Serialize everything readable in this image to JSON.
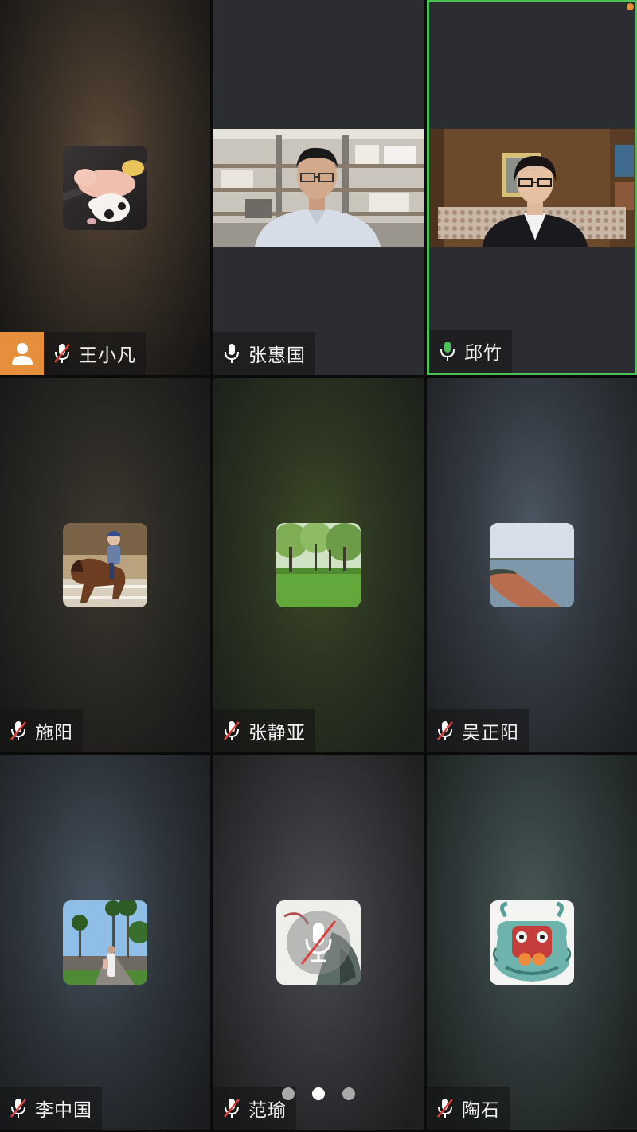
{
  "participants": [
    {
      "name": "王小凡",
      "mic": "muted",
      "host": true,
      "avatar": "pig-figurines-photo"
    },
    {
      "name": "张惠国",
      "mic": "on",
      "video": "man-in-office-video"
    },
    {
      "name": "邱竹",
      "mic": "speaking",
      "video": "woman-in-study-video",
      "active_speaker": true
    },
    {
      "name": "施阳",
      "mic": "muted",
      "avatar": "child-on-horse-photo"
    },
    {
      "name": "张静亚",
      "mic": "muted",
      "avatar": "park-trees-photo"
    },
    {
      "name": "吴正阳",
      "mic": "muted",
      "avatar": "lakeside-path-photo"
    },
    {
      "name": "李中国",
      "mic": "muted",
      "avatar": "palm-road-photo"
    },
    {
      "name": "范瑜",
      "mic": "muted",
      "avatar": "ink-lotus-muted-photo"
    },
    {
      "name": "陶石",
      "mic": "muted",
      "avatar": "dragon-mask-illustration"
    }
  ],
  "pagination": {
    "total": 3,
    "current": 2
  },
  "colors": {
    "active_speaker": "#4cc159",
    "host_badge": "#e58e3c",
    "mic_speaking": "#4cc159",
    "mic_muted_slash": "#e0413c"
  }
}
